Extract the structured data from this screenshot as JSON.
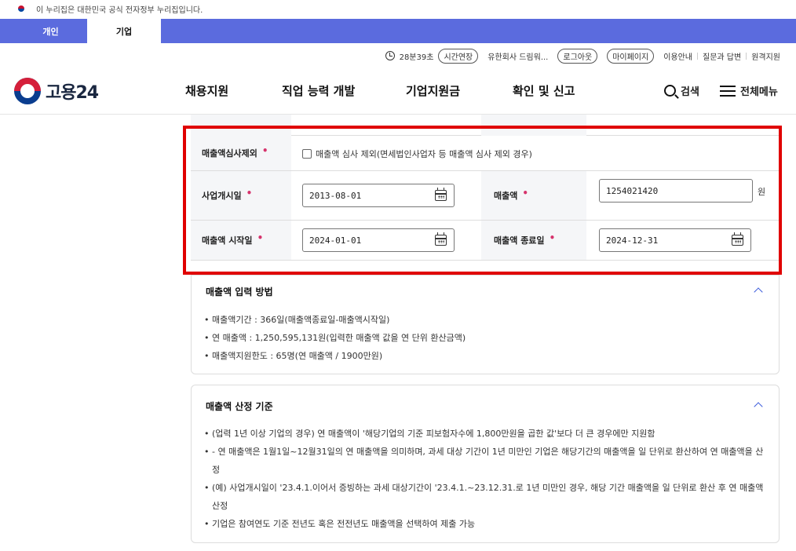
{
  "gov_banner": {
    "text": "이 누리집은 대한민국 공식 전자정부 누리집입니다."
  },
  "tabs": [
    {
      "label": "개인"
    },
    {
      "label": "기업"
    }
  ],
  "utility": {
    "timer": "28분39초",
    "extend_label": "시간연장",
    "company": "유한회사 드림워...",
    "logout_label": "로그아웃",
    "mypage_label": "마이페이지",
    "links": [
      "이용안내",
      "질문과 답변",
      "원격지원"
    ]
  },
  "header": {
    "logo_text": "고용24",
    "nav": [
      "채용지원",
      "직업 능력 개발",
      "기업지원금",
      "확인 및 신고"
    ],
    "search_label": "검색",
    "menu_label": "전체메뉴"
  },
  "form": {
    "exclude_label": "매출액심사제외",
    "exclude_checkbox_label": "매출액 심사 제외(면세법인사업자 등 매출액 심사 제외 경우)",
    "start_date_label": "사업개시일",
    "start_date_value": "2013-08-01",
    "revenue_label": "매출액",
    "revenue_value": "1254021420",
    "revenue_unit": "원",
    "revenue_start_label": "매출액 시작일",
    "revenue_start_value": "2024-01-01",
    "revenue_end_label": "매출액 종료일",
    "revenue_end_value": "2024-12-31",
    "required_mark": "•"
  },
  "panel1": {
    "title": "매출액 입력 방법",
    "items": [
      "매출액기간 : 366일(매출액종료일-매출액시작일)",
      "연 매출액 : 1,250,595,131원(입력한 매출액 값을 연 단위 환산금액)",
      "매출액지원한도 : 65명(연 매출액 / 1900만원)"
    ]
  },
  "panel2": {
    "title": "매출액 산정 기준",
    "items": [
      "(업력 1년 이상 기업의 경우) 연 매출액이 '해당기업의 기준 피보험자수에 1,800만원을 곱한 값'보다 더 큰 경우에만 지원함",
      "- 연 매출액은 1월1일~12월31일의 연 매출액을 의미하며, 과세 대상 기간이 1년 미만인 기업은 해당기간의 매출액을 일 단위로 환산하여 연 매출액을 산정",
      "(예) 사업개시일이 '23.4.1.이어서 증빙하는 과세 대상기간이 '23.4.1.~23.12.31.로 1년 미만인 경우, 해당 기간 매출액을 일 단위로 환산 후 연 매출액 산정",
      "기업은 참여연도 기준 전년도 혹은 전전년도 매출액을 선택하여 제출 가능"
    ]
  }
}
